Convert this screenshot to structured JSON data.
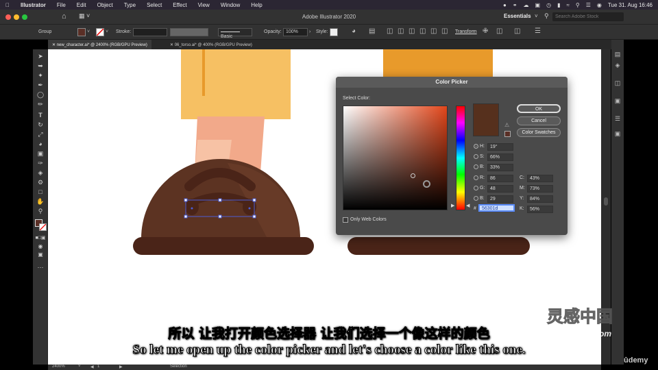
{
  "menubar": {
    "app": "Illustrator",
    "items": [
      "File",
      "Edit",
      "Object",
      "Type",
      "Select",
      "Effect",
      "View",
      "Window",
      "Help"
    ],
    "clock": "Tue 31. Aug  16:46"
  },
  "titlebar": {
    "title": "Adobe Illustrator 2020",
    "workspace": "Essentials",
    "search_placeholder": "Search Adobe Stock"
  },
  "controlbar": {
    "selection": "Group",
    "stroke_label": "Stroke:",
    "brush": "Basic",
    "opacity_label": "Opacity:",
    "opacity_value": "100%",
    "style_label": "Style:",
    "transform": "Transform",
    "fill_color": "#5a2f26"
  },
  "tabs": [
    {
      "label": "new_character.ai* @ 2400% (RGB/GPU Preview)"
    },
    {
      "label": "06_torso.ai* @ 400% (RGB/GPU Preview)"
    }
  ],
  "statusbar": {
    "zoom": "2400%",
    "artboard": "1",
    "tool": "Selection"
  },
  "picker": {
    "title": "Color Picker",
    "select_label": "Select Color:",
    "ok": "OK",
    "cancel": "Cancel",
    "swatches": "Color Swatches",
    "preview_color": "#56301d",
    "hsb": [
      {
        "label": "H:",
        "value": "19°",
        "checked": true
      },
      {
        "label": "S:",
        "value": "66%",
        "checked": false
      },
      {
        "label": "B:",
        "value": "33%",
        "checked": false
      }
    ],
    "rgb": [
      {
        "label": "R:",
        "value": "86"
      },
      {
        "label": "G:",
        "value": "48"
      },
      {
        "label": "B:",
        "value": "29"
      }
    ],
    "cmyk": [
      {
        "label": "C:",
        "value": "43%"
      },
      {
        "label": "M:",
        "value": "73%"
      },
      {
        "label": "Y:",
        "value": "84%"
      },
      {
        "label": "K:",
        "value": "56%"
      }
    ],
    "hex_label": "#",
    "hex_value": "56301d",
    "web_colors": "Only Web Colors"
  },
  "subtitles": {
    "zh": "所以 让我打开颜色选择器 让我们选择一个像这样的颜色",
    "en": "So let me open up the color picker and let's choose a color like this one."
  },
  "watermark": {
    "cn": "灵感中国",
    "url": "lingganchina.com",
    "udemy": "ûdemy"
  },
  "colors": {
    "shoe_dark": "#4a2418",
    "shoe_body": "#5c3322",
    "shoe_highlight": "#6a3c29",
    "pants": "#f6c063",
    "pants_seam": "#e89a2b",
    "pants_right": "#e89a2b",
    "skin": "#f2a98a",
    "skin_light": "#f7c2a5",
    "selection": "#4b5cd6"
  }
}
